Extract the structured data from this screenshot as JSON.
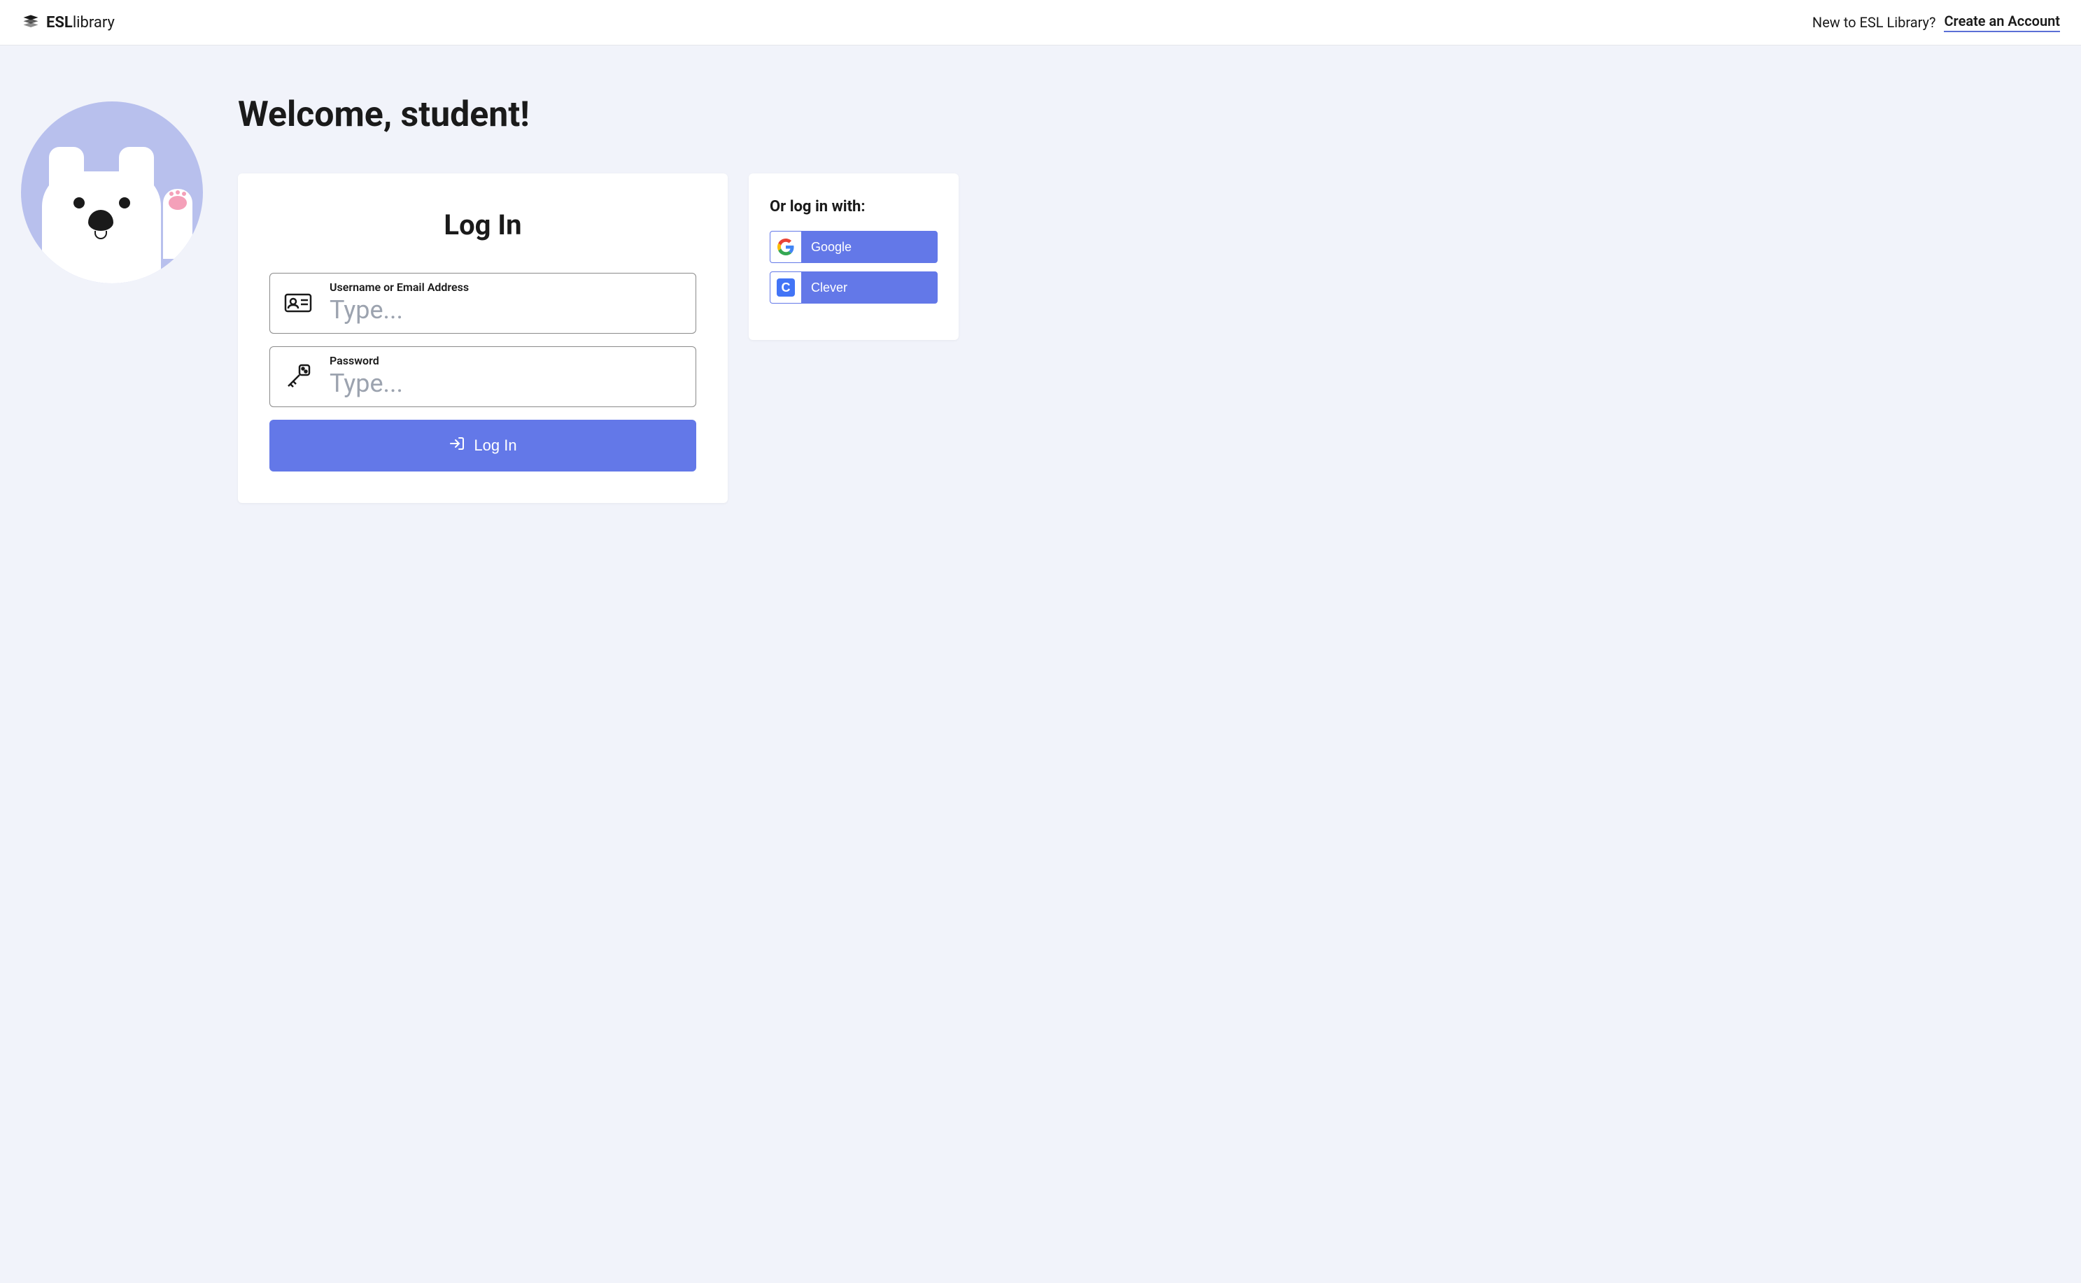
{
  "header": {
    "logo_bold": "ESL",
    "logo_light": "library",
    "prompt_text": "New to ESL Library?",
    "create_account": "Create an Account"
  },
  "main": {
    "welcome_heading": "Welcome, student!",
    "login_title": "Log In",
    "username_label": "Username or Email Address",
    "username_placeholder": "Type...",
    "password_label": "Password",
    "password_placeholder": "Type...",
    "login_button": "Log In"
  },
  "oauth": {
    "title": "Or log in with:",
    "google_label": "Google",
    "clever_label": "Clever"
  }
}
